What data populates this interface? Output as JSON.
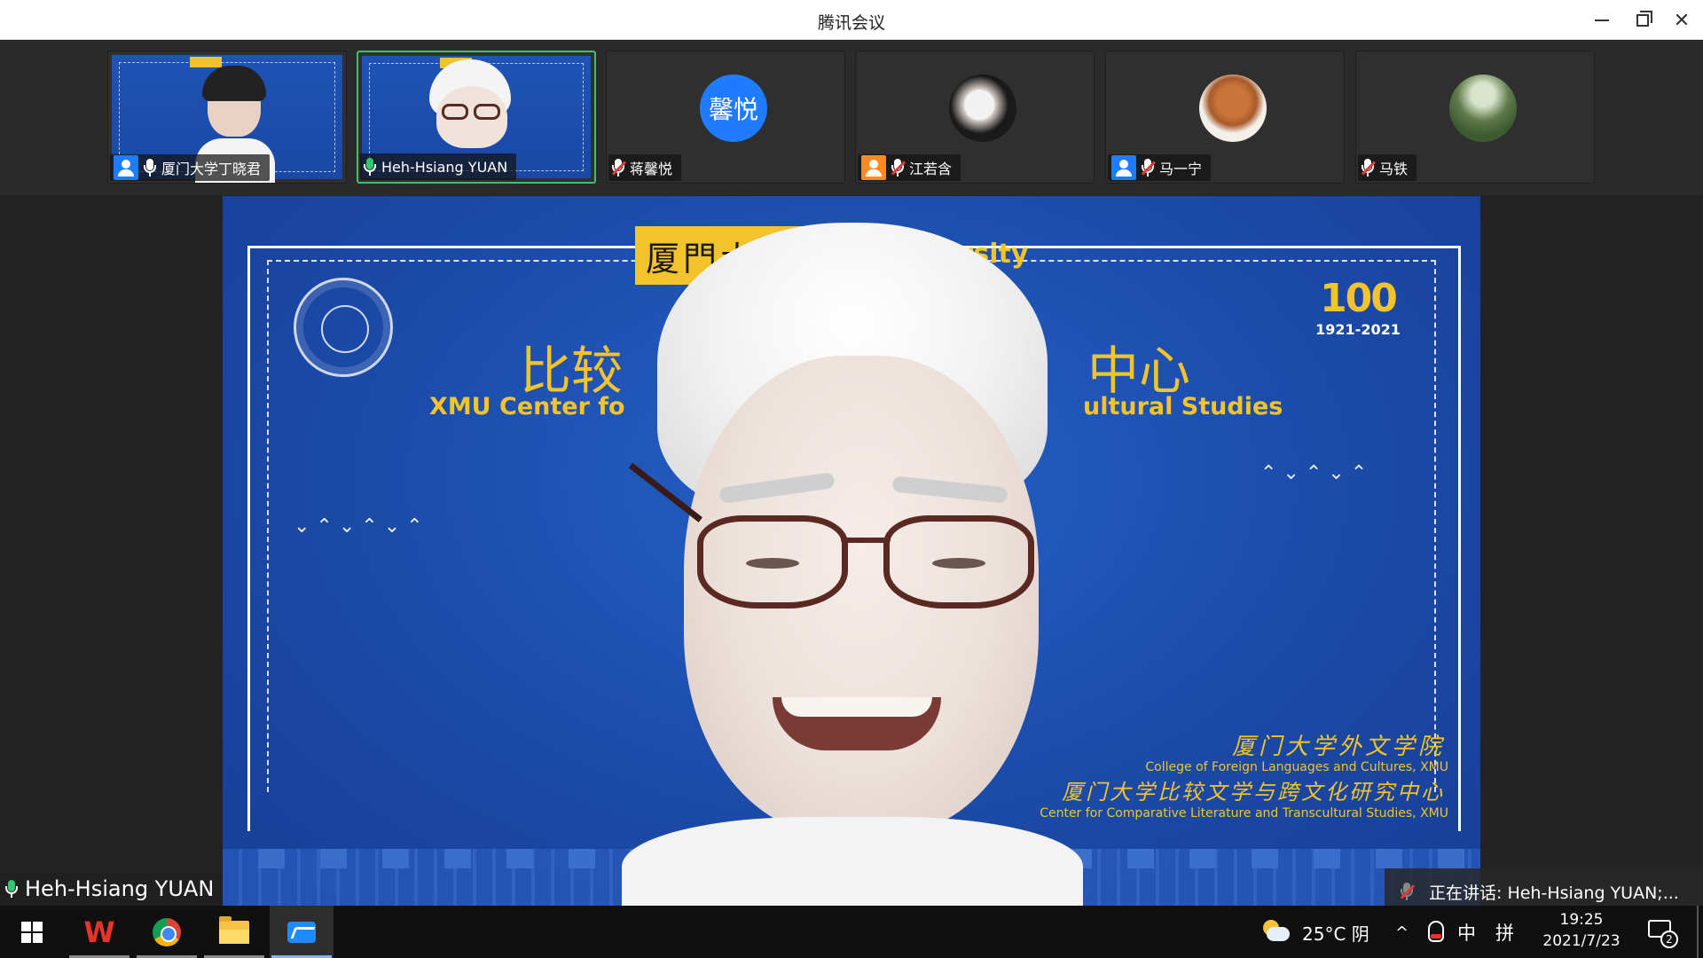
{
  "window": {
    "title": "腾讯会议"
  },
  "participants": [
    {
      "name": "厦门大学丁晓君",
      "mic": "on",
      "has_user_icon": true,
      "user_icon_color": "#1f7bff",
      "type": "video"
    },
    {
      "name": "Heh-Hsiang YUAN",
      "mic": "speaking",
      "has_user_icon": false,
      "type": "video",
      "active": true
    },
    {
      "name": "蒋馨悦",
      "mic": "muted",
      "has_user_icon": false,
      "type": "avatar",
      "avatar_text": "馨悦",
      "avatar_color": "#1f7bff"
    },
    {
      "name": "江若含",
      "mic": "muted",
      "has_user_icon": true,
      "user_icon_color": "#ff8a1f",
      "type": "avatar",
      "avatar_icon": "cat-photo-icon"
    },
    {
      "name": "马一宁",
      "mic": "muted",
      "has_user_icon": true,
      "user_icon_color": "#1f7bff",
      "type": "avatar",
      "avatar_icon": "reading-animal-photo-icon"
    },
    {
      "name": "马铁",
      "mic": "muted",
      "has_user_icon": false,
      "type": "avatar",
      "avatar_icon": "tree-landscape-photo-icon"
    }
  ],
  "main_video": {
    "speaker_name": "Heh-Hsiang YUAN",
    "background": {
      "logo_text": "厦門大",
      "university_en": "niversity",
      "title_cn_left": "比较",
      "title_cn_right": "中心",
      "subtitle_en_left": "XMU Center fo",
      "subtitle_en_right": "ultural Studies",
      "centennial_number": "100",
      "centennial_years": "1921-2021",
      "college_cn": "厦门大学外文学院",
      "college_en": "College of Foreign Languages and Cultures, XMU",
      "center_cn": "厦门大学比较文学与跨文化研究中心",
      "center_en": "Center for Comparative Literature and Transcultural Studies, XMU"
    }
  },
  "speaking_indicator": {
    "text": "正在讲话: Heh-Hsiang YUAN;..."
  },
  "taskbar": {
    "apps": [
      {
        "name": "windows-start",
        "icon": "windows-logo-icon"
      },
      {
        "name": "wps-office",
        "icon": "wps-icon",
        "label": "W"
      },
      {
        "name": "chrome",
        "icon": "chrome-icon"
      },
      {
        "name": "file-explorer",
        "icon": "folder-icon"
      },
      {
        "name": "tencent-meeting",
        "icon": "tencent-meeting-icon"
      }
    ],
    "weather": "25°C  阴",
    "tray_chevron": "^",
    "ime_lang": "中",
    "ime_mode": "拼",
    "time": "19:25",
    "date": "2021/7/23",
    "notification_count": "2"
  },
  "colors": {
    "accent_green": "#34c56f",
    "brand_blue": "#1f7bff",
    "gold": "#f2c32a",
    "muted_red": "#e53935"
  }
}
